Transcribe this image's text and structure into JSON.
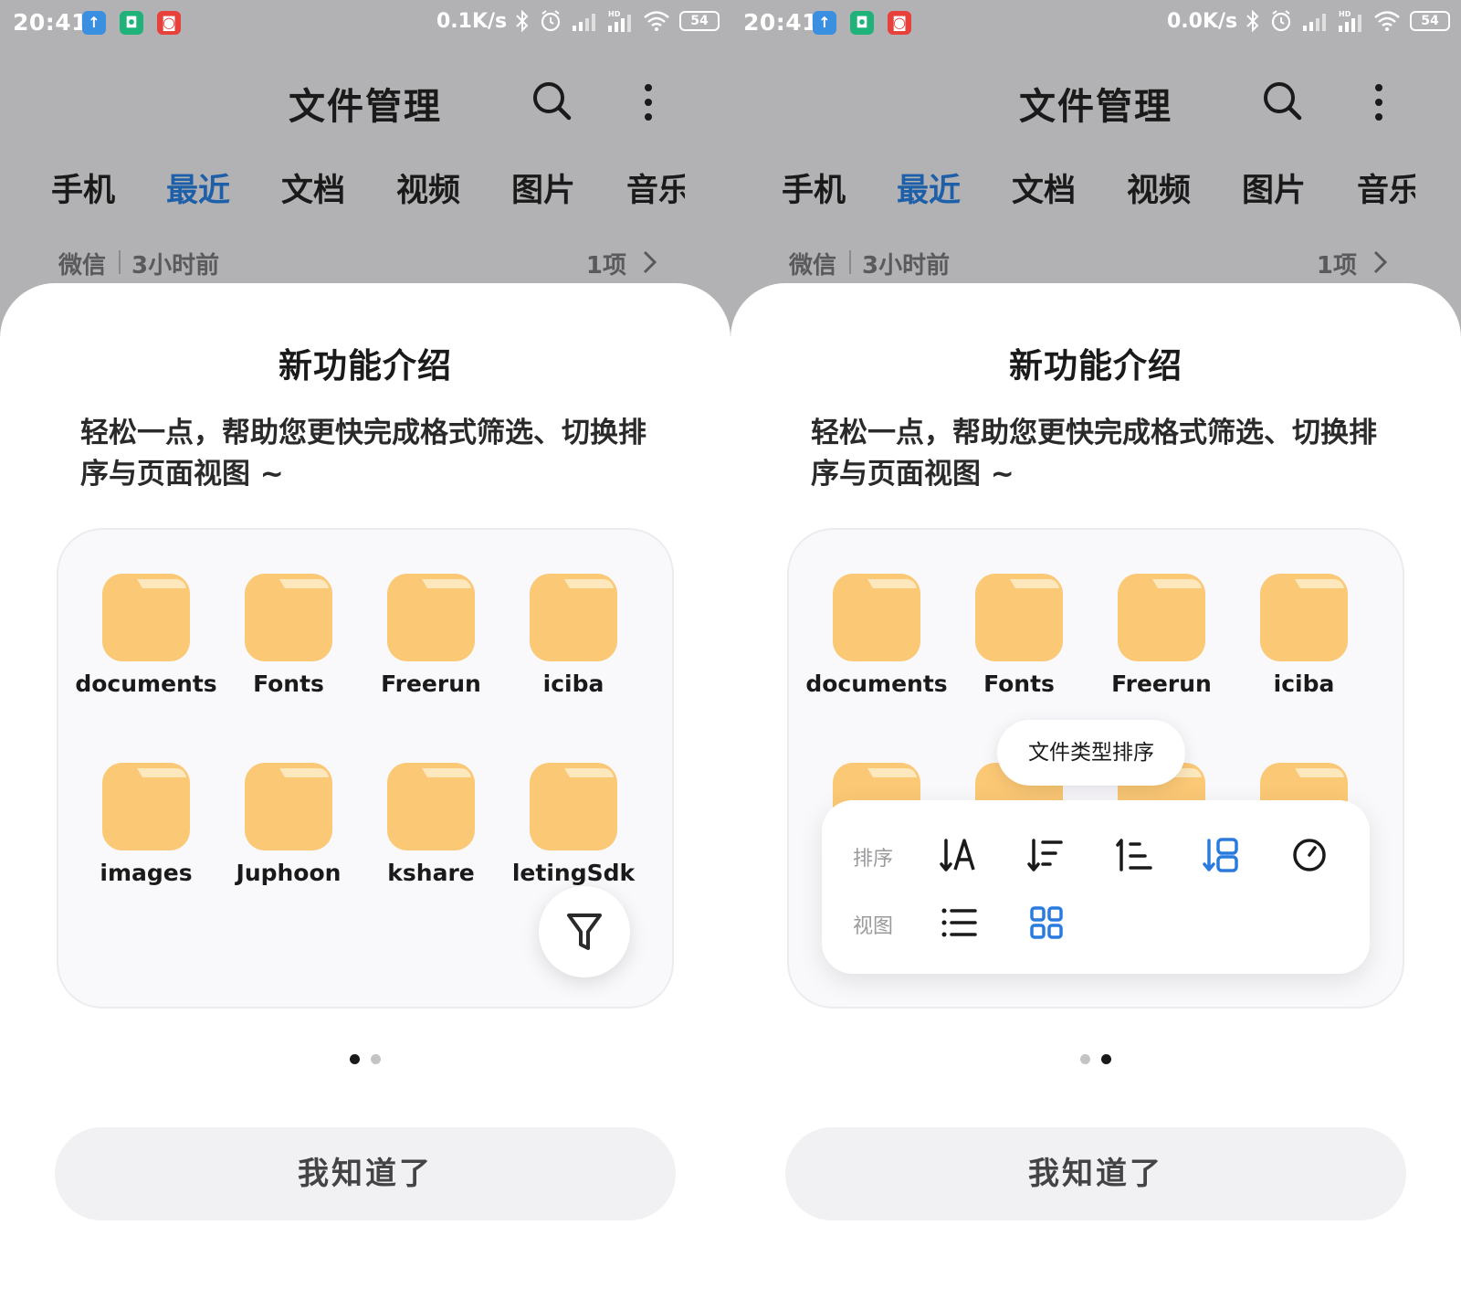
{
  "colors": {
    "accent": "#1d5fa8",
    "overlay_bg": "#b2b2b4",
    "folder": "#fbc875",
    "folder_tab": "#fde7bd",
    "active_icon": "#2a7be0"
  },
  "screens": [
    {
      "status": {
        "time": "20:41",
        "speed": "0.1K/s",
        "battery": "54"
      },
      "header": {
        "title": "文件管理"
      },
      "tabs": [
        "手机",
        "最近",
        "文档",
        "视频",
        "图片",
        "音乐"
      ],
      "active_tab": 1,
      "recent": {
        "source": "微信",
        "ago": "3小时前",
        "count": "1项"
      },
      "sheet": {
        "title": "新功能介绍",
        "description": "轻松一点，帮助您更快完成格式筛选、切换排序与页面视图 ~",
        "folders": [
          "documents",
          "Fonts",
          "Freerun",
          "iciba",
          "images",
          "Juphoon",
          "kshare",
          "letingSdk"
        ],
        "button": "我知道了",
        "page": 1
      }
    },
    {
      "status": {
        "time": "20:41",
        "speed": "0.0K/s",
        "battery": "54"
      },
      "header": {
        "title": "文件管理"
      },
      "tabs": [
        "手机",
        "最近",
        "文档",
        "视频",
        "图片",
        "音乐"
      ],
      "active_tab": 1,
      "recent": {
        "source": "微信",
        "ago": "3小时前",
        "count": "1项"
      },
      "sheet": {
        "title": "新功能介绍",
        "description": "轻松一点，帮助您更快完成格式筛选、切换排序与页面视图 ~",
        "folders": [
          "documents",
          "Fonts",
          "Freerun",
          "iciba"
        ],
        "tooltip": "文件类型排序",
        "sort_panel": {
          "sort_label": "排序",
          "view_label": "视图",
          "sort_icons": [
            "sort-by-name-icon",
            "sort-by-size-icon",
            "sort-by-type-ascending-icon",
            "sort-by-file-type-icon",
            "sort-by-time-icon"
          ],
          "view_icons": [
            "list-view-icon",
            "grid-view-icon"
          ],
          "selected_sort": "sort-by-file-type-icon",
          "selected_view": "grid-view-icon"
        },
        "button": "我知道了",
        "page": 2
      }
    }
  ]
}
